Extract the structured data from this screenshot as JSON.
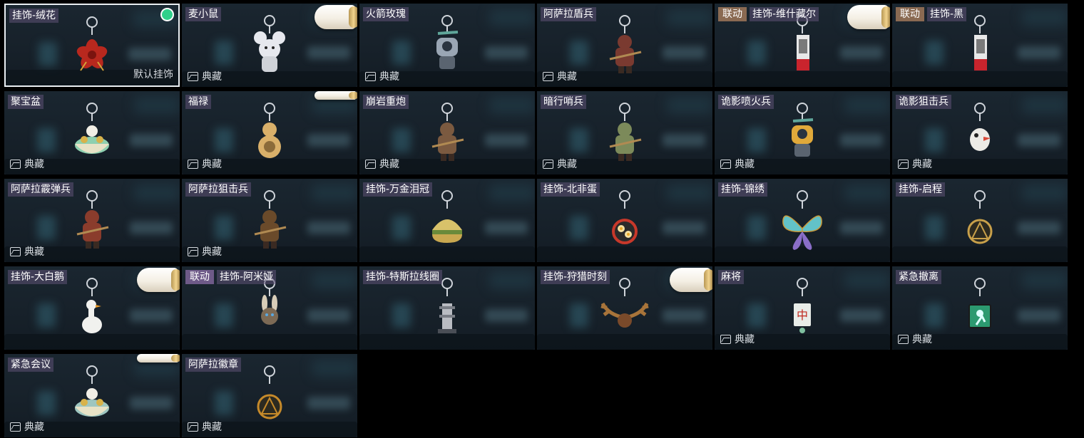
{
  "items": [
    {
      "name": "挂饰-绒花",
      "collab": "",
      "footer": "",
      "default_label": "默认挂饰",
      "selected": true,
      "scroll": "",
      "charm": "flower",
      "color": "#b8281e"
    },
    {
      "name": "麦小鼠",
      "collab": "",
      "footer": "典藏",
      "default_label": "",
      "selected": false,
      "scroll": "big",
      "charm": "mouse",
      "color": "#e6e8ee"
    },
    {
      "name": "火箭玫瑰",
      "collab": "",
      "footer": "典藏",
      "default_label": "",
      "selected": false,
      "scroll": "",
      "charm": "robot",
      "color": "#9aa6b4"
    },
    {
      "name": "阿萨拉盾兵",
      "collab": "",
      "footer": "典藏",
      "default_label": "",
      "selected": false,
      "scroll": "",
      "charm": "soldier",
      "color": "#7a3a30"
    },
    {
      "name": "挂饰-维什藏尔",
      "collab": "联动",
      "collab_color": "brown",
      "footer": "",
      "default_label": "",
      "selected": false,
      "scroll": "big",
      "charm": "card",
      "color": "#c9242d"
    },
    {
      "name": "挂饰-黑",
      "collab": "联动",
      "collab_color": "brown",
      "footer": "",
      "default_label": "",
      "selected": false,
      "scroll": "",
      "charm": "card",
      "color": "#c9242d"
    },
    {
      "name": "聚宝盆",
      "collab": "",
      "footer": "典藏",
      "default_label": "",
      "selected": false,
      "scroll": "",
      "charm": "bowl",
      "color": "#8fd0b0"
    },
    {
      "name": "福禄",
      "collab": "",
      "footer": "典藏",
      "default_label": "",
      "selected": false,
      "scroll": "small",
      "charm": "gourd",
      "color": "#d9b06a"
    },
    {
      "name": "崩岩重炮",
      "collab": "",
      "footer": "典藏",
      "default_label": "",
      "selected": false,
      "scroll": "",
      "charm": "soldier",
      "color": "#7b5a40"
    },
    {
      "name": "暗行哨兵",
      "collab": "",
      "footer": "典藏",
      "default_label": "",
      "selected": false,
      "scroll": "",
      "charm": "soldier",
      "color": "#7c8a5a"
    },
    {
      "name": "诡影喷火兵",
      "collab": "",
      "footer": "典藏",
      "default_label": "",
      "selected": false,
      "scroll": "",
      "charm": "robot",
      "color": "#e0a93a"
    },
    {
      "name": "诡影狙击兵",
      "collab": "",
      "footer": "典藏",
      "default_label": "",
      "selected": false,
      "scroll": "",
      "charm": "bird",
      "color": "#ecebe6"
    },
    {
      "name": "阿萨拉霰弹兵",
      "collab": "",
      "footer": "典藏",
      "default_label": "",
      "selected": false,
      "scroll": "",
      "charm": "soldier",
      "color": "#8a3c2c"
    },
    {
      "name": "阿萨拉狙击兵",
      "collab": "",
      "footer": "典藏",
      "default_label": "",
      "selected": false,
      "scroll": "",
      "charm": "soldier",
      "color": "#6a4a2a"
    },
    {
      "name": "挂饰-万金泪冠",
      "collab": "",
      "footer": "",
      "default_label": "",
      "selected": false,
      "scroll": "",
      "charm": "burger",
      "color": "#d8c26a"
    },
    {
      "name": "挂饰-北非蛋",
      "collab": "",
      "footer": "",
      "default_label": "",
      "selected": false,
      "scroll": "",
      "charm": "pan",
      "color": "#c7382a"
    },
    {
      "name": "挂饰-锦绣",
      "collab": "",
      "footer": "",
      "default_label": "",
      "selected": false,
      "scroll": "",
      "charm": "butterfly",
      "color": "#62c2c8"
    },
    {
      "name": "挂饰-启程",
      "collab": "",
      "footer": "",
      "default_label": "",
      "selected": false,
      "scroll": "",
      "charm": "medal",
      "color": "#c8a04a"
    },
    {
      "name": "挂饰-大白鹅",
      "collab": "",
      "footer": "",
      "default_label": "",
      "selected": false,
      "scroll": "big",
      "charm": "goose",
      "color": "#f1f1ee"
    },
    {
      "name": "挂饰-阿米娅",
      "collab": "联动",
      "collab_color": "purple",
      "footer": "",
      "default_label": "",
      "selected": false,
      "scroll": "",
      "charm": "rabbit",
      "color": "#7c6a55"
    },
    {
      "name": "挂饰-特斯拉线圈",
      "collab": "",
      "footer": "",
      "default_label": "",
      "selected": false,
      "scroll": "",
      "charm": "tower",
      "color": "#b9bcc2"
    },
    {
      "name": "挂饰-狩猎时刻",
      "collab": "",
      "footer": "",
      "default_label": "",
      "selected": false,
      "scroll": "big",
      "charm": "antlers",
      "color": "#a8743a"
    },
    {
      "name": "麻将",
      "collab": "",
      "footer": "典藏",
      "default_label": "",
      "selected": false,
      "scroll": "",
      "charm": "mahjong",
      "color": "#e8ece8"
    },
    {
      "name": "紧急撤离",
      "collab": "",
      "footer": "典藏",
      "default_label": "",
      "selected": false,
      "scroll": "",
      "charm": "sign",
      "color": "#2c9a70"
    },
    {
      "name": "紧急会议",
      "collab": "",
      "footer": "典藏",
      "default_label": "",
      "selected": false,
      "scroll": "small",
      "charm": "bowl",
      "color": "#9ec6c0"
    },
    {
      "name": "阿萨拉徽章",
      "collab": "",
      "footer": "典藏",
      "default_label": "",
      "selected": false,
      "scroll": "",
      "charm": "medal",
      "color": "#c68a2a"
    }
  ]
}
